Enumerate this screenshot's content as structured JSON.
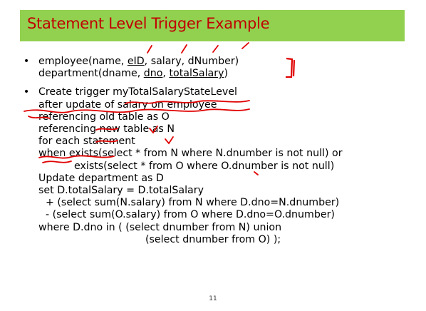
{
  "slide": {
    "title": "Statement Level Trigger Example",
    "bullet_char": "•",
    "schema_lines": {
      "employee": {
        "pre": "employee(name, ",
        "eid": "eID",
        "mid": ", salary, dNumber)"
      },
      "department": {
        "pre": "department(dname, ",
        "dno": "dno",
        "mid": ", ",
        "total": "totalSalary",
        "post": ")"
      }
    },
    "trigger_lines": [
      "Create trigger myTotalSalaryStateLevel",
      "after update of salary on employee",
      "referencing old table as O",
      "referencing new table as N",
      "for each statement",
      "when exists(select * from N where N.dnumber is not null) or",
      "exists(select * from O where O.dnumber is not null)",
      "Update department as D",
      "set D.totalSalary = D.totalSalary",
      "+ (select sum(N.salary) from N where D.dno=N.dnumber)",
      "- (select sum(O.salary) from O where D.dno=O.dnumber)",
      "where D.dno in ( (select dnumber from N) union",
      "(select dnumber from O) );"
    ],
    "page_number": "11"
  },
  "colors": {
    "title_bg": "#92d050",
    "title_text": "#c00000",
    "ink": "#e00000"
  }
}
